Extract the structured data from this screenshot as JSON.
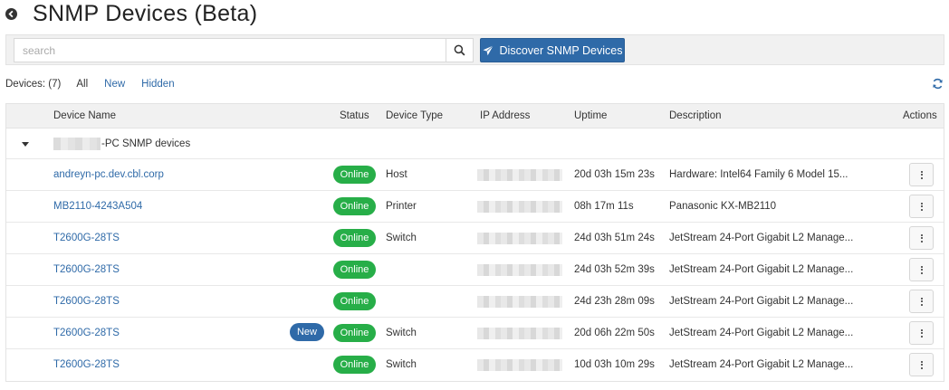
{
  "header": {
    "title": "SNMP Devices (Beta)",
    "back_icon": "arrow-left-circle-icon"
  },
  "search": {
    "placeholder": "search",
    "value": "",
    "search_icon": "magnifier-icon"
  },
  "toolbar": {
    "discover_label": "Discover SNMP Devices",
    "discover_icon": "paper-plane-icon",
    "accent_color": "#2f6aa8"
  },
  "filters": {
    "devices_count": "Devices: (7)",
    "tabs": [
      "All",
      "New",
      "Hidden"
    ],
    "refresh_icon": "refresh-icon"
  },
  "table": {
    "columns": [
      "Device Name",
      "Status",
      "Device Type",
      "IP Address",
      "Uptime",
      "Description",
      "Actions"
    ],
    "group": {
      "label": "-PC SNMP devices",
      "expanded": true
    },
    "rows": [
      {
        "name": "andreyn-pc.dev.cbl.corp",
        "new": "",
        "status": "Online",
        "type": "Host",
        "uptime": "20d 03h 15m 23s",
        "description": "Hardware: Intel64 Family 6 Model 15..."
      },
      {
        "name": "MB2110-4243A504",
        "new": "",
        "status": "Online",
        "type": "Printer",
        "uptime": "08h 17m 11s",
        "description": "Panasonic KX-MB2110"
      },
      {
        "name": "T2600G-28TS",
        "new": "",
        "status": "Online",
        "type": "Switch",
        "uptime": "24d 03h 51m 24s",
        "description": "JetStream 24-Port Gigabit L2 Manage..."
      },
      {
        "name": "T2600G-28TS",
        "new": "",
        "status": "Online",
        "type": "",
        "uptime": "24d 03h 52m 39s",
        "description": "JetStream 24-Port Gigabit L2 Manage..."
      },
      {
        "name": "T2600G-28TS",
        "new": "",
        "status": "Online",
        "type": "",
        "uptime": "24d 23h 28m 09s",
        "description": "JetStream 24-Port Gigabit L2 Manage..."
      },
      {
        "name": "T2600G-28TS",
        "new": "New",
        "status": "Online",
        "type": "Switch",
        "uptime": "20d 06h 22m 50s",
        "description": "JetStream 24-Port Gigabit L2 Manage..."
      },
      {
        "name": "T2600G-28TS",
        "new": "",
        "status": "Online",
        "type": "Switch",
        "uptime": "10d 03h 10m 29s",
        "description": "JetStream 24-Port Gigabit L2 Manage..."
      }
    ],
    "status_color": "#27ae48",
    "actions_icon": "kebab-menu-icon"
  }
}
